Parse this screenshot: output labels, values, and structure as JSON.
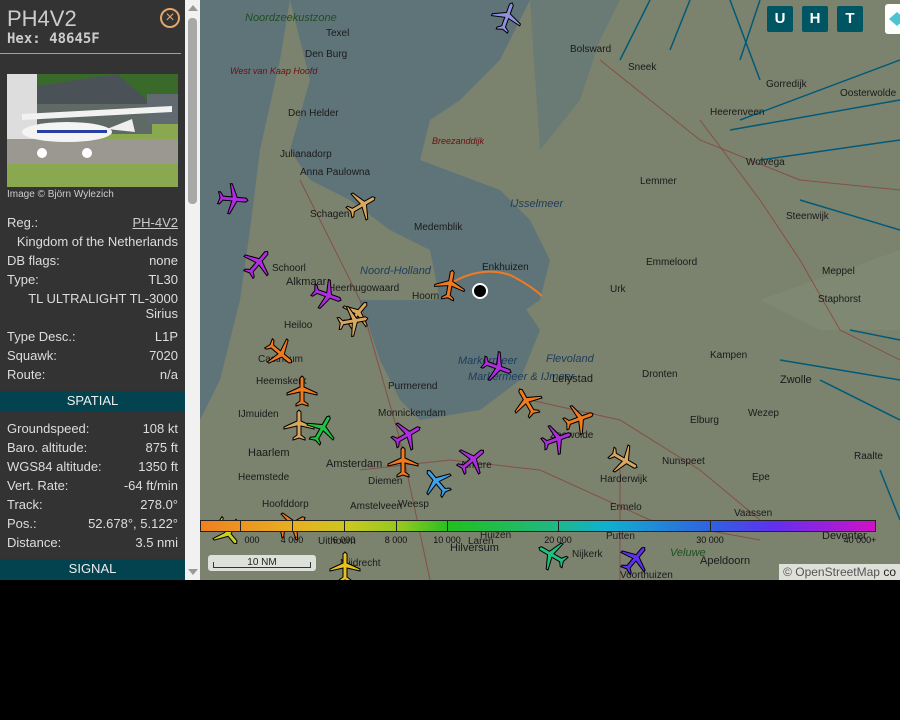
{
  "aircraft": {
    "callsign": "PH4V2",
    "hex_label": "Hex:",
    "hex": "48645F",
    "image_credit": "Image © Björn Wylezich",
    "details": [
      {
        "label": "Reg.:",
        "value": "PH-4V2"
      },
      {
        "label": "",
        "value": "Kingdom of the Netherlands"
      },
      {
        "label": "DB flags:",
        "value": "none"
      },
      {
        "label": "Type:",
        "value": "TL30"
      },
      {
        "label": "",
        "value": "TL ULTRALIGHT TL-3000 Sirius"
      },
      {
        "label": "Type Desc.:",
        "value": "L1P"
      },
      {
        "label": "Squawk:",
        "value": "7020"
      },
      {
        "label": "Route:",
        "value": "n/a"
      }
    ],
    "sections": {
      "spatial": "SPATIAL",
      "signal": "SIGNAL"
    },
    "spatial": [
      {
        "label": "Groundspeed:",
        "value": "108 kt"
      },
      {
        "label": "Baro. altitude:",
        "value": "875 ft"
      },
      {
        "label": "WGS84 altitude:",
        "value": "1350 ft"
      },
      {
        "label": "Vert. Rate:",
        "value": "-64 ft/min"
      },
      {
        "label": "Track:",
        "value": "278.0°"
      },
      {
        "label": "Pos.:",
        "value": "52.678°, 5.122°"
      },
      {
        "label": "Distance:",
        "value": "3.5 nmi"
      }
    ]
  },
  "map": {
    "buttons": [
      "U",
      "H",
      "T"
    ],
    "scale": "10 NM",
    "attribution": {
      "prefix": "©",
      "link": "OpenStreetMap",
      "suffix": "co"
    },
    "altitude_legend": [
      "000",
      "4 000",
      "6 000",
      "8 000",
      "10 000",
      "20 000",
      "30 000",
      "40 000+"
    ],
    "labels": [
      {
        "t": "Noordzeekustzone",
        "c": "green"
      },
      {
        "t": "Texel",
        "c": ""
      },
      {
        "t": "Den Burg",
        "c": ""
      },
      {
        "t": "West van Kaap Hoofd",
        "c": "red"
      },
      {
        "t": "Den Helder",
        "c": ""
      },
      {
        "t": "Breezanddijk",
        "c": "red"
      },
      {
        "t": "Julianadorp",
        "c": ""
      },
      {
        "t": "Anna Paulowna",
        "c": ""
      },
      {
        "t": "Schagen",
        "c": ""
      },
      {
        "t": "Medemblik",
        "c": ""
      },
      {
        "t": "IJsselmeer",
        "c": "water"
      },
      {
        "t": "Noord-Holland",
        "c": "water"
      },
      {
        "t": "Enkhuizen",
        "c": ""
      },
      {
        "t": "Schoorl",
        "c": ""
      },
      {
        "t": "Alkmaar",
        "c": "big"
      },
      {
        "t": "Heerhugowaard",
        "c": ""
      },
      {
        "t": "Hoorn",
        "c": ""
      },
      {
        "t": "Heiloo",
        "c": ""
      },
      {
        "t": "Castricum",
        "c": ""
      },
      {
        "t": "Heemskerk",
        "c": ""
      },
      {
        "t": "Purmerend",
        "c": ""
      },
      {
        "t": "IJmuiden",
        "c": ""
      },
      {
        "t": "Markermeer",
        "c": "water"
      },
      {
        "t": "Markermeer & IJmeer",
        "c": "water"
      },
      {
        "t": "Flevoland",
        "c": "water"
      },
      {
        "t": "Lelystad",
        "c": "big"
      },
      {
        "t": "Monnickendam",
        "c": ""
      },
      {
        "t": "Haarlem",
        "c": "big"
      },
      {
        "t": "Amsterdam",
        "c": "big"
      },
      {
        "t": "Diemen",
        "c": ""
      },
      {
        "t": "Heemstede",
        "c": ""
      },
      {
        "t": "Hoofddorp",
        "c": ""
      },
      {
        "t": "Amstelveen",
        "c": ""
      },
      {
        "t": "Weesp",
        "c": ""
      },
      {
        "t": "Almere",
        "c": ""
      },
      {
        "t": "Huizen",
        "c": ""
      },
      {
        "t": "Uithoorn",
        "c": ""
      },
      {
        "t": "Hilversum",
        "c": "big"
      },
      {
        "t": "Laren",
        "c": ""
      },
      {
        "t": "Mijdrecht",
        "c": ""
      },
      {
        "t": "Bolsward",
        "c": ""
      },
      {
        "t": "Sneek",
        "c": ""
      },
      {
        "t": "Gorredijk",
        "c": ""
      },
      {
        "t": "Heerenveen",
        "c": ""
      },
      {
        "t": "Oosterwolde",
        "c": ""
      },
      {
        "t": "Wolvega",
        "c": ""
      },
      {
        "t": "Lemmer",
        "c": ""
      },
      {
        "t": "Steenwijk",
        "c": ""
      },
      {
        "t": "Emmeloord",
        "c": ""
      },
      {
        "t": "Meppel",
        "c": ""
      },
      {
        "t": "Staphorst",
        "c": ""
      },
      {
        "t": "Urk",
        "c": ""
      },
      {
        "t": "Kampen",
        "c": ""
      },
      {
        "t": "Dronten",
        "c": ""
      },
      {
        "t": "Zwolle",
        "c": "big"
      },
      {
        "t": "Elburg",
        "c": ""
      },
      {
        "t": "Wezep",
        "c": ""
      },
      {
        "t": "Nunspeet",
        "c": ""
      },
      {
        "t": "Harderwijk",
        "c": ""
      },
      {
        "t": "Raalte",
        "c": ""
      },
      {
        "t": "Epe",
        "c": ""
      },
      {
        "t": "Ermelo",
        "c": ""
      },
      {
        "t": "Vaassen",
        "c": ""
      },
      {
        "t": "Putten",
        "c": ""
      },
      {
        "t": "Nijkerk",
        "c": ""
      },
      {
        "t": "Veluwe",
        "c": "green"
      },
      {
        "t": "Apeldoorn",
        "c": "big"
      },
      {
        "t": "Deventer",
        "c": "big"
      },
      {
        "t": "Voorthuizen",
        "c": ""
      },
      {
        "t": "Zeewolde",
        "c": ""
      }
    ],
    "planes": [
      {
        "color": "#b02ce0",
        "rot": 95
      },
      {
        "color": "#b02ce0",
        "rot": 40
      },
      {
        "color": "#b02ce0",
        "rot": 110
      },
      {
        "color": "#d8a860",
        "rot": 60
      },
      {
        "color": "#f07a20",
        "rot": 10
      },
      {
        "color": "#d8a860",
        "rot": 40
      },
      {
        "color": "#d8a860",
        "rot": 80
      },
      {
        "color": "#f07a20",
        "rot": 130
      },
      {
        "color": "#f07a20",
        "rot": 0
      },
      {
        "color": "#d8a860",
        "rot": 0
      },
      {
        "color": "#20c040",
        "rot": 30
      },
      {
        "color": "#b02ce0",
        "rot": 60
      },
      {
        "color": "#f07a20",
        "rot": 0
      },
      {
        "color": "#b02ce0",
        "rot": 50
      },
      {
        "color": "#40a0e8",
        "rot": -40
      },
      {
        "color": "#b02ce0",
        "rot": 110
      },
      {
        "color": "#f07a20",
        "rot": -30
      },
      {
        "color": "#b02ce0",
        "rot": 70
      },
      {
        "color": "#f07a20",
        "rot": 70
      },
      {
        "color": "#d8a860",
        "rot": 120
      },
      {
        "color": "#c8d020",
        "rot": 140
      },
      {
        "color": "#f07a20",
        "rot": 60
      },
      {
        "color": "#e8c020",
        "rot": 0
      },
      {
        "color": "#20c080",
        "rot": -60
      },
      {
        "color": "#6030f0",
        "rot": 40
      },
      {
        "color": "#9090e0",
        "rot": 20
      }
    ]
  }
}
